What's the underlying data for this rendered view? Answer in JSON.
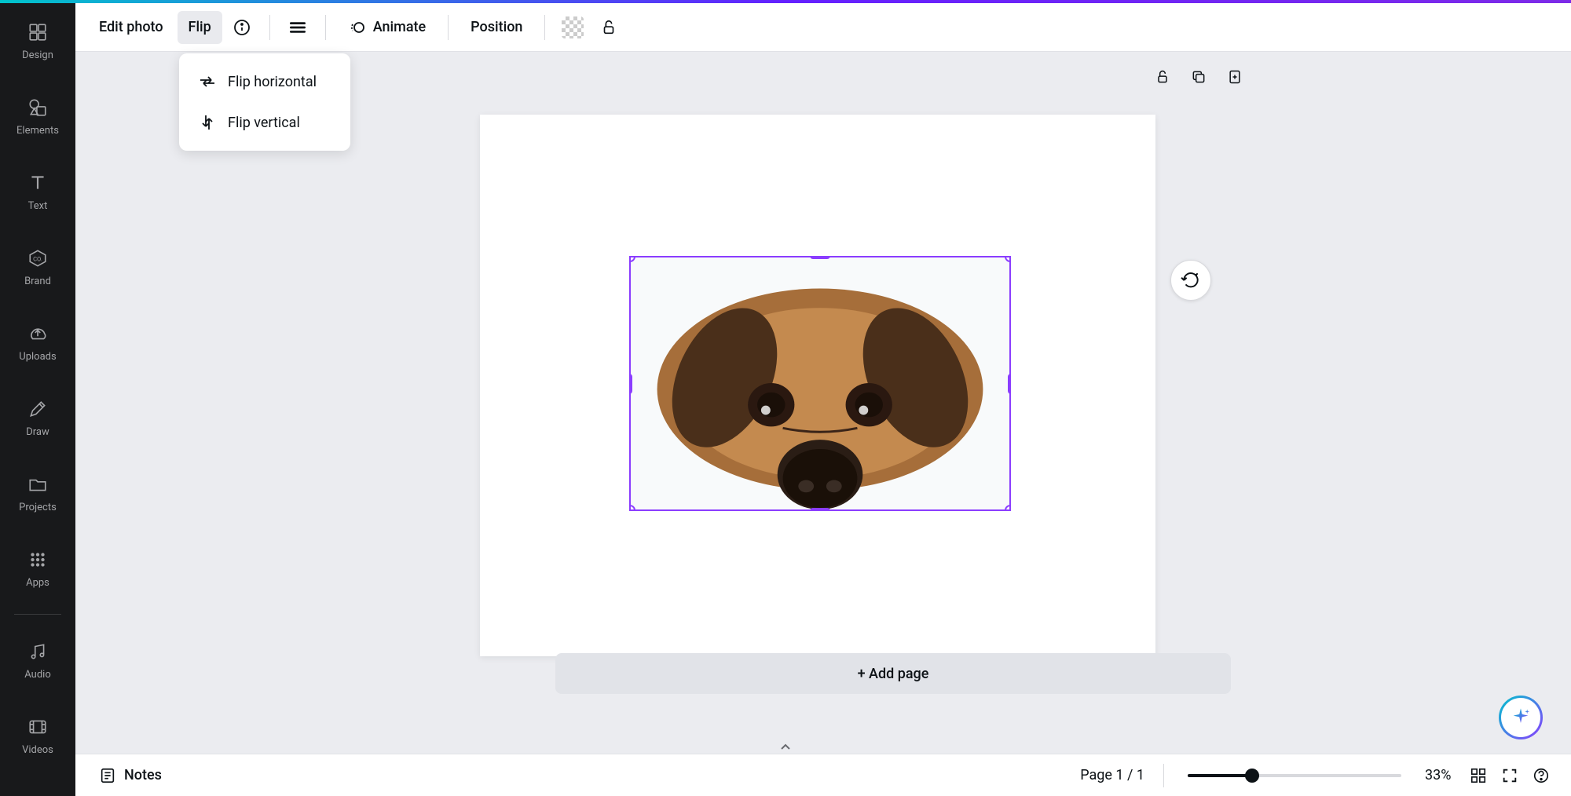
{
  "sidebar": {
    "items": [
      {
        "label": "Design"
      },
      {
        "label": "Elements"
      },
      {
        "label": "Text"
      },
      {
        "label": "Brand"
      },
      {
        "label": "Uploads"
      },
      {
        "label": "Draw"
      },
      {
        "label": "Projects"
      },
      {
        "label": "Apps"
      },
      {
        "label": "Audio"
      },
      {
        "label": "Videos"
      }
    ]
  },
  "toolbar": {
    "edit_photo": "Edit photo",
    "flip": "Flip",
    "animate": "Animate",
    "position": "Position"
  },
  "dropdown": {
    "flip_horizontal": "Flip horizontal",
    "flip_vertical": "Flip vertical"
  },
  "canvas": {
    "add_page": "+ Add page"
  },
  "bottombar": {
    "notes": "Notes",
    "page_indicator": "Page 1 / 1",
    "zoom": "33%"
  }
}
